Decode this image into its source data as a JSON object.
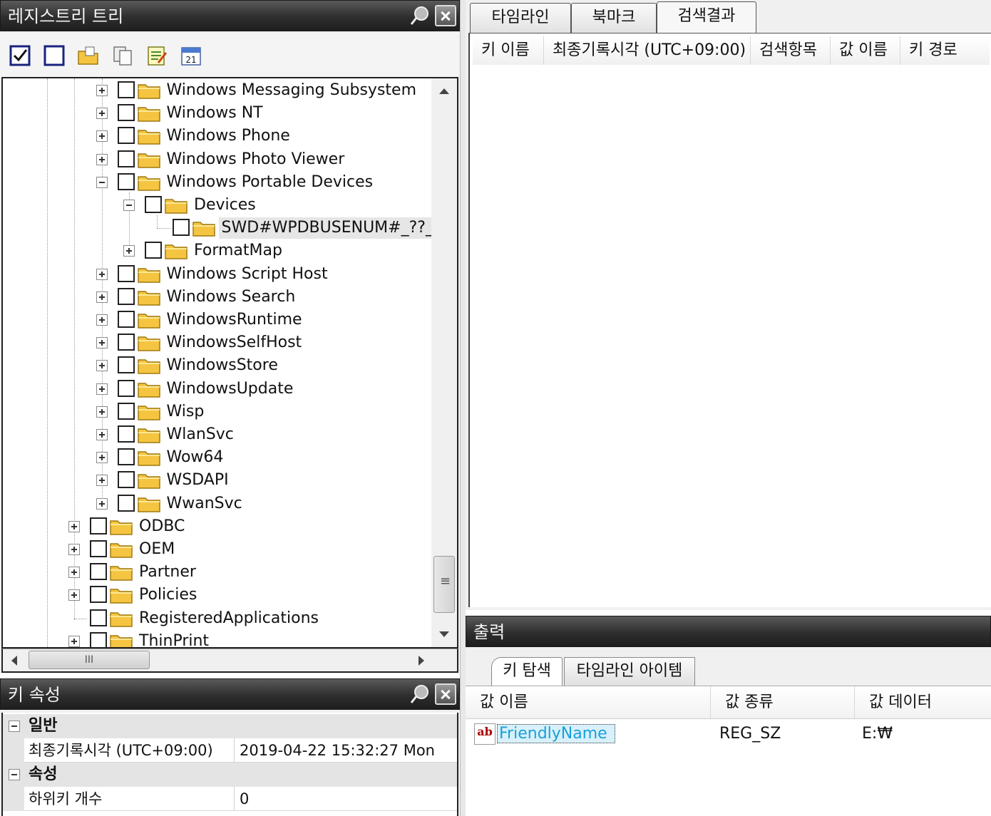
{
  "tree_panel": {
    "title": "레지스트리 트리",
    "items": [
      {
        "label": "Windows Messaging Subsystem",
        "expander": "plus"
      },
      {
        "label": "Windows NT",
        "expander": "plus"
      },
      {
        "label": "Windows Phone",
        "expander": "plus"
      },
      {
        "label": "Windows Photo Viewer",
        "expander": "plus"
      },
      {
        "label": "Windows Portable Devices",
        "expander": "minus"
      },
      {
        "label": "Devices",
        "expander": "minus"
      },
      {
        "label": "SWD#WPDBUSENUM#_??_USB",
        "expander": "none",
        "selected": true
      },
      {
        "label": "FormatMap",
        "expander": "plus"
      },
      {
        "label": "Windows Script Host",
        "expander": "plus"
      },
      {
        "label": "Windows Search",
        "expander": "plus"
      },
      {
        "label": "WindowsRuntime",
        "expander": "plus"
      },
      {
        "label": "WindowsSelfHost",
        "expander": "plus"
      },
      {
        "label": "WindowsStore",
        "expander": "plus"
      },
      {
        "label": "WindowsUpdate",
        "expander": "plus"
      },
      {
        "label": "Wisp",
        "expander": "plus"
      },
      {
        "label": "WlanSvc",
        "expander": "plus"
      },
      {
        "label": "Wow64",
        "expander": "plus"
      },
      {
        "label": "WSDAPI",
        "expander": "plus"
      },
      {
        "label": "WwanSvc",
        "expander": "plus"
      },
      {
        "label": "ODBC",
        "expander": "plus"
      },
      {
        "label": "OEM",
        "expander": "plus"
      },
      {
        "label": "Partner",
        "expander": "plus"
      },
      {
        "label": "Policies",
        "expander": "plus"
      },
      {
        "label": "RegisteredApplications",
        "expander": "none"
      },
      {
        "label": "ThinPrint",
        "expander": "plus"
      }
    ],
    "hscroll_thumb_text": "III"
  },
  "props_panel": {
    "title": "키 속성",
    "general_category": "일반",
    "last_write_label": "최종기록시각 (UTC+09:00)",
    "last_write_value": "2019-04-22  15:32:27  Mon",
    "attributes_category": "속성",
    "subkey_count_label": "하위키 개수",
    "subkey_count_value": "0"
  },
  "right_tabs": {
    "timeline": "타임라인",
    "bookmark": "북마크",
    "search_results": "검색결과",
    "active": "search_results"
  },
  "search_columns": {
    "key_name": "키 이름",
    "last_write": "최종기록시각 (UTC+09:00)",
    "search_item": "검색항목",
    "value_name": "값 이름",
    "key_path": "키 경로"
  },
  "output_panel": {
    "title": "출력",
    "tab_key_browse": "키 탐색",
    "tab_timeline_item": "타임라인 아이템",
    "col_value_name": "값 이름",
    "col_value_type": "값 종류",
    "col_value_data": "값 데이터",
    "rows": [
      {
        "icon": "ab",
        "name": "FriendlyName",
        "type": "REG_SZ",
        "data": "E:₩"
      }
    ]
  },
  "colors": {
    "titlebar_dark": "#2e2e2e",
    "selected_value_text": "#1aa0d8",
    "folder_yellow": "#f5c542"
  }
}
